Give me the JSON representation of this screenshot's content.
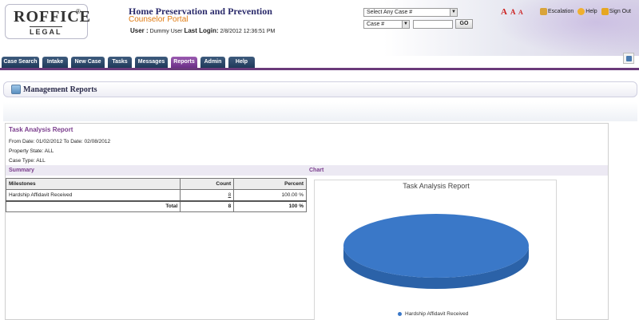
{
  "header": {
    "logo_text": "ROFFICE",
    "logo_reg": "®",
    "logo_sub": "LEGAL",
    "app_title": "Home Preservation and Prevention",
    "app_subtitle": "Counselor Portal",
    "user_label": "User :",
    "user_name": "Dummy User",
    "last_login_label": "Last Login:",
    "last_login_value": "2/8/2012 12:36:51 PM",
    "case_select_value": "Select Any Case #",
    "case_field_select_value": "Case #",
    "go_label": "GO",
    "font_sizes": [
      "A",
      "A",
      "A"
    ],
    "links": {
      "escalation": "Escalation",
      "help": "Help",
      "sign_out": "Sign Out"
    }
  },
  "nav": {
    "tabs": [
      {
        "label": "Case Search",
        "active": false
      },
      {
        "label": "Intake",
        "active": false
      },
      {
        "label": "New Case",
        "active": false
      },
      {
        "label": "Tasks",
        "active": false
      },
      {
        "label": "Messages",
        "active": false
      },
      {
        "label": "Reports",
        "active": true
      },
      {
        "label": "Admin",
        "active": false
      },
      {
        "label": "Help",
        "active": false
      }
    ]
  },
  "page": {
    "title": "Management Reports"
  },
  "report": {
    "title": "Task Analysis Report",
    "date_range": "From Date: 01/02/2012 To Date: 02/08/2012",
    "property_state": "Property State: ALL",
    "case_type": "Case Type: ALL",
    "summary_label": "Summary",
    "chart_label": "Chart",
    "table": {
      "headers": [
        "Milestones",
        "Count",
        "Percent"
      ],
      "rows": [
        {
          "milestone": "Hardship Affidavit Received",
          "count": "8",
          "percent": "100.00 %"
        }
      ],
      "total": {
        "label": "Total",
        "count": "8",
        "percent": "100 %"
      }
    }
  },
  "chart_data": {
    "type": "pie",
    "title": "Task Analysis Report",
    "categories": [
      "Hardship Affidavit  Received"
    ],
    "values": [
      8
    ],
    "colors": [
      "#3a78c8"
    ],
    "legend_position": "bottom"
  }
}
